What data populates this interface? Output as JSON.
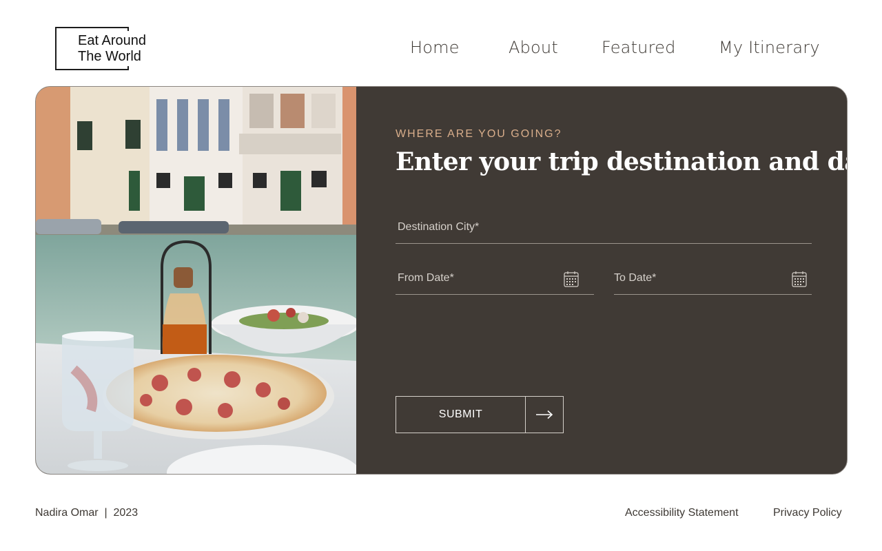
{
  "header": {
    "logo_line1": "Eat Around",
    "logo_line2": "The World",
    "nav": [
      {
        "label": "Home"
      },
      {
        "label": "About"
      },
      {
        "label": "Featured"
      },
      {
        "label": "My Itinerary"
      }
    ]
  },
  "form": {
    "kicker": "WHERE ARE YOU GOING?",
    "headline": "Enter your trip destination and dates",
    "destination_label": "Destination City*",
    "from_label": "From Date*",
    "to_label": "To Date*",
    "submit_label": "SUBMIT"
  },
  "footer": {
    "credit": "Nadira Omar  |  2023",
    "links": [
      {
        "label": "Accessibility Statement"
      },
      {
        "label": "Privacy Policy"
      }
    ]
  },
  "colors": {
    "panel": "#403a35",
    "accent": "#d9ae8b",
    "text": "#3d3833"
  },
  "icons": [
    "calendar-icon",
    "calendar-icon",
    "arrow-right-icon"
  ]
}
